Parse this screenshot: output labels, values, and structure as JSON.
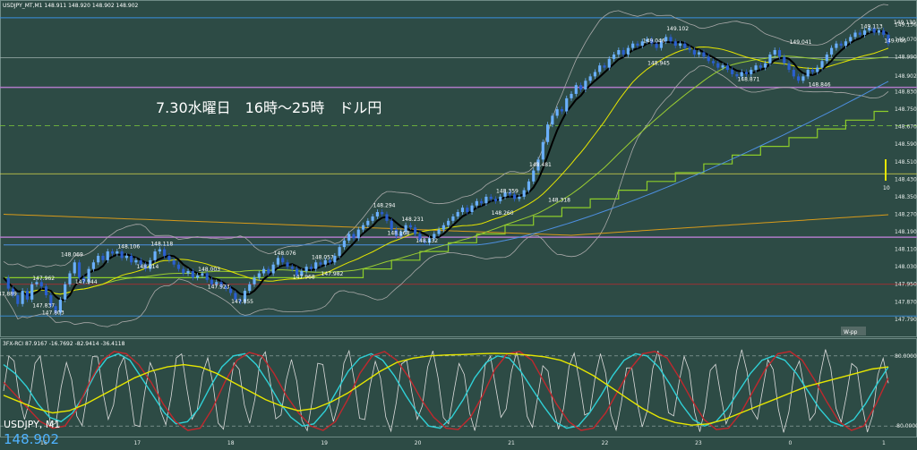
{
  "header": {
    "main_info": "USDJPY_MT,M1  148.911 148.920 148.902 148.902",
    "osc_info": "3FX-RCI 87.9167 -16.7692 -82.9414 -36.4118"
  },
  "annotation": "7.30水曜日　16時～25時　ドル円",
  "symbol_label": "USDJPY, M1",
  "last_price": "148.902",
  "wpp_label": "W-pp",
  "bar_count_label": "10",
  "colors": {
    "background": "#2d4b45",
    "price_black": "#000000",
    "ma_yellow": "#e6e600",
    "ma_yellowgreen": "#9acd32",
    "step_green": "#8ccc2a",
    "ma_blue": "#4d8fe0",
    "ma_orange": "#d79a1a",
    "level_blue": "#3a8fe0",
    "level_purple": "#b07ac8",
    "rci_white": "#dcdcdc",
    "rci_red": "#c0282d",
    "rci_cyan": "#2fd0d6",
    "rci_yellow": "#e6e600",
    "candle_up": "#6ab0ff",
    "candle_down": "#2a5fd0"
  },
  "chart_data": [
    {
      "type": "candlestick",
      "title": "USDJPY_MT,M1",
      "x_ticks": [
        "16",
        "17",
        "18",
        "19",
        "20",
        "21",
        "22",
        "23",
        "0",
        "1"
      ],
      "ylim": [
        147.72,
        149.2
      ],
      "y_ticks": [
        "149.136",
        "149.070",
        "148.990",
        "148.902",
        "148.830",
        "148.750",
        "148.670",
        "148.590",
        "148.510",
        "148.430",
        "148.350",
        "148.270",
        "148.190",
        "148.110",
        "148.030",
        "147.950",
        "147.870",
        "147.790"
      ],
      "price_labels": [
        {
          "x": 0,
          "value": 147.889,
          "text": "147.889"
        },
        {
          "x": 8,
          "value": 147.837,
          "text": "147.837"
        },
        {
          "x": 10,
          "value": 147.803,
          "text": "147.803"
        },
        {
          "x": 8,
          "value": 147.962,
          "text": "147.962"
        },
        {
          "x": 14,
          "value": 148.069,
          "text": "148.069"
        },
        {
          "x": 17,
          "value": 147.944,
          "text": "147.944"
        },
        {
          "x": 26,
          "value": 148.106,
          "text": "148.106"
        },
        {
          "x": 30,
          "value": 148.014,
          "text": "148.014"
        },
        {
          "x": 33,
          "value": 148.118,
          "text": "148.118"
        },
        {
          "x": 43,
          "value": 148.003,
          "text": "148.003"
        },
        {
          "x": 45,
          "value": 147.923,
          "text": "147.923"
        },
        {
          "x": 50,
          "value": 147.855,
          "text": "147.855"
        },
        {
          "x": 59,
          "value": 148.076,
          "text": "148.076"
        },
        {
          "x": 63,
          "value": 147.968,
          "text": "147.968"
        },
        {
          "x": 67,
          "value": 148.057,
          "text": "148.057"
        },
        {
          "x": 69,
          "value": 147.982,
          "text": "147.982"
        },
        {
          "x": 80,
          "value": 148.294,
          "text": "148.294"
        },
        {
          "x": 86,
          "value": 148.231,
          "text": "148.231"
        },
        {
          "x": 83,
          "value": 148.168,
          "text": "148.168"
        },
        {
          "x": 89,
          "value": 148.132,
          "text": "148.132"
        },
        {
          "x": 106,
          "value": 148.359,
          "text": "148.359"
        },
        {
          "x": 105,
          "value": 148.26,
          "text": "148.260"
        },
        {
          "x": 113,
          "value": 148.481,
          "text": "148.481"
        },
        {
          "x": 117,
          "value": 148.318,
          "text": "148.318"
        },
        {
          "x": 137,
          "value": 149.046,
          "text": "149.046"
        },
        {
          "x": 142,
          "value": 149.102,
          "text": "149.102"
        },
        {
          "x": 138,
          "value": 148.945,
          "text": "148.945"
        },
        {
          "x": 157,
          "value": 148.871,
          "text": "148.871"
        },
        {
          "x": 168,
          "value": 149.041,
          "text": "149.041"
        },
        {
          "x": 172,
          "value": 148.846,
          "text": "148.846"
        },
        {
          "x": 183,
          "value": 149.113,
          "text": "149.113"
        },
        {
          "x": 190,
          "value": 149.13,
          "text": "149.130"
        },
        {
          "x": 188,
          "value": 149.046,
          "text": "149.046"
        }
      ],
      "closes": [
        147.98,
        147.93,
        147.9,
        147.86,
        147.92,
        147.88,
        147.95,
        147.96,
        147.94,
        147.9,
        147.85,
        147.82,
        147.88,
        147.95,
        148.0,
        148.05,
        147.98,
        147.96,
        148.02,
        148.05,
        148.08,
        148.06,
        148.1,
        148.09,
        148.1,
        148.07,
        148.08,
        148.05,
        148.06,
        148.04,
        148.02,
        148.06,
        148.1,
        148.11,
        148.08,
        148.06,
        148.04,
        148.02,
        148.0,
        148.01,
        147.98,
        147.99,
        148.0,
        147.97,
        147.95,
        147.96,
        147.94,
        147.93,
        147.91,
        147.88,
        147.87,
        147.92,
        147.95,
        147.98,
        148.0,
        148.02,
        148.0,
        148.04,
        148.07,
        148.05,
        148.03,
        148.02,
        147.99,
        148.01,
        148.03,
        148.02,
        148.05,
        148.04,
        148.06,
        148.05,
        148.08,
        148.12,
        148.15,
        148.18,
        148.16,
        148.2,
        148.22,
        148.24,
        148.26,
        148.28,
        148.27,
        148.24,
        148.2,
        148.17,
        148.19,
        148.22,
        148.21,
        148.18,
        148.15,
        148.14,
        148.16,
        148.18,
        148.2,
        148.22,
        148.24,
        148.26,
        148.28,
        148.3,
        148.28,
        148.31,
        148.33,
        148.32,
        148.35,
        148.34,
        148.33,
        148.35,
        148.37,
        148.36,
        148.34,
        148.35,
        148.38,
        148.42,
        148.47,
        148.52,
        148.6,
        148.68,
        148.72,
        148.75,
        148.74,
        148.8,
        148.82,
        148.86,
        148.84,
        148.88,
        148.9,
        148.92,
        148.95,
        148.94,
        148.98,
        149.0,
        149.02,
        149.0,
        149.03,
        149.05,
        149.04,
        149.06,
        149.07,
        149.05,
        149.03,
        149.06,
        149.08,
        149.06,
        149.04,
        149.05,
        149.03,
        149.02,
        149.0,
        149.01,
        148.99,
        148.97,
        148.96,
        148.94,
        148.95,
        148.93,
        148.91,
        148.9,
        148.92,
        148.91,
        148.93,
        148.95,
        148.94,
        148.96,
        149.0,
        149.02,
        148.99,
        148.96,
        148.93,
        148.9,
        148.88,
        148.9,
        148.93,
        148.92,
        148.94,
        148.97,
        149.0,
        149.03,
        149.05,
        149.04,
        149.06,
        149.08,
        149.1,
        149.09,
        149.11,
        149.12,
        149.1,
        149.11,
        149.09,
        149.05
      ]
    },
    {
      "type": "line",
      "title": "3FX-RCI",
      "ylim": [
        -100,
        100
      ],
      "y_ticks": [
        "80.0000",
        "-80.0000"
      ],
      "series": [
        {
          "color": "rci_cyan",
          "values": [
            60,
            40,
            10,
            -30,
            -60,
            -70,
            -50,
            -10,
            40,
            75,
            85,
            70,
            30,
            -10,
            -50,
            -75,
            -70,
            -40,
            10,
            55,
            80,
            85,
            60,
            20,
            -25,
            -60,
            -80,
            -75,
            -45,
            0,
            45,
            75,
            85,
            70,
            35,
            -10,
            -50,
            -80,
            -85,
            -60,
            -20,
            30,
            65,
            80,
            75,
            45,
            5,
            -35,
            -70,
            -85,
            -80,
            -50,
            -10,
            35,
            70,
            85,
            80,
            55,
            15,
            -30,
            -65,
            -80,
            -70,
            -40,
            0,
            40,
            70,
            80,
            70,
            40,
            0,
            -40,
            -70,
            -80,
            -65,
            -30,
            15,
            55
          ]
        },
        {
          "color": "rci_red",
          "values": [
            20,
            -10,
            -40,
            -70,
            -85,
            -80,
            -40,
            20,
            70,
            90,
            85,
            60,
            20,
            -30,
            -70,
            -90,
            -85,
            -40,
            20,
            70,
            88,
            80,
            40,
            -10,
            -50,
            -80,
            -90,
            -70,
            -20,
            40,
            80,
            90,
            70,
            30,
            -20,
            -60,
            -85,
            -88,
            -60,
            -10,
            50,
            85,
            90,
            70,
            20,
            -30,
            -70,
            -90,
            -85,
            -50,
            0,
            50,
            85,
            90,
            75,
            30,
            -20,
            -65,
            -88,
            -85,
            -50,
            0,
            50,
            85,
            90,
            70,
            25,
            -25,
            -70,
            -90,
            -80,
            -30,
            30
          ]
        },
        {
          "color": "rci_yellow",
          "values": [
            -10,
            -25,
            -40,
            -50,
            -45,
            -30,
            -10,
            10,
            30,
            45,
            55,
            60,
            55,
            40,
            20,
            0,
            -20,
            -35,
            -45,
            -40,
            -25,
            -5,
            20,
            45,
            65,
            75,
            80,
            82,
            83,
            85,
            86,
            85,
            82,
            78,
            70,
            55,
            35,
            10,
            -15,
            -40,
            -60,
            -72,
            -78,
            -75,
            -65,
            -50,
            -35,
            -20,
            -5,
            10,
            20,
            30,
            40,
            50,
            55
          ]
        }
      ]
    }
  ]
}
